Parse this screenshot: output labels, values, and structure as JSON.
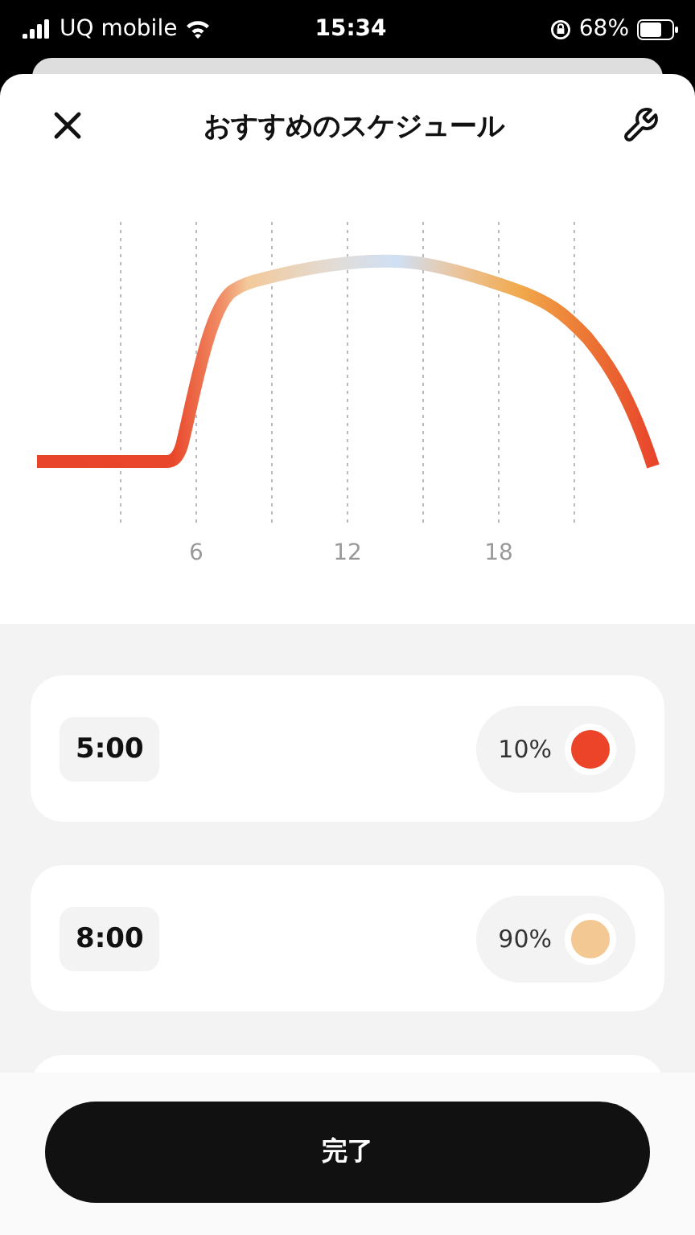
{
  "status_bar": {
    "carrier": "UQ mobile",
    "time": "15:34",
    "battery": "68%"
  },
  "header": {
    "title": "おすすめのスケジュール"
  },
  "chart": {
    "x_labels": [
      "6",
      "12",
      "18"
    ]
  },
  "schedule": [
    {
      "time": "5:00",
      "percent": "10%",
      "color": "#ec4428"
    },
    {
      "time": "8:00",
      "percent": "90%",
      "color": "#f4c892"
    }
  ],
  "done_button": "完了"
}
